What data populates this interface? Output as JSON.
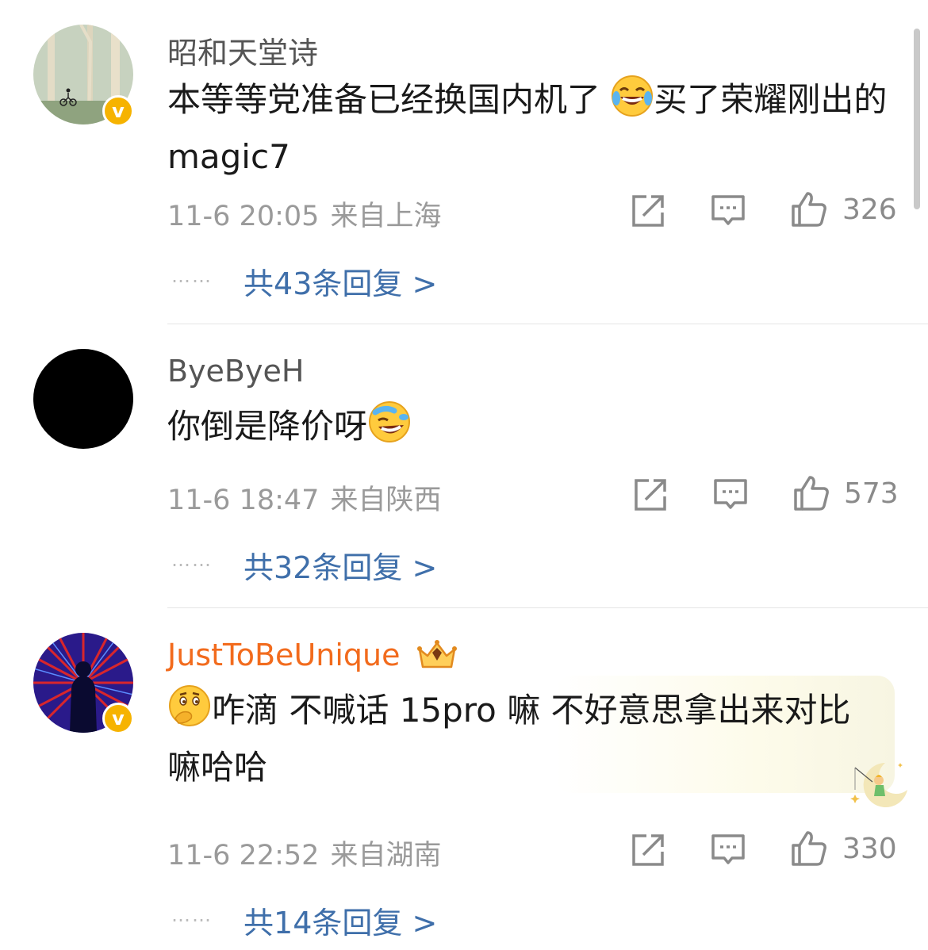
{
  "comments": [
    {
      "username": "昭和天堂诗",
      "text_before": "本等等党准备已经换国内机了",
      "emoji_1": "laughing-tears-emoji",
      "text_after": "买了荣耀刚出的 magic7",
      "date": "11-6 20:05",
      "location": "来自上海",
      "likes": "326",
      "replies_prefix": "共",
      "replies_count": "43",
      "replies_suffix": "条回复 >"
    },
    {
      "username": "ByeByeH",
      "text_before": "你倒是降价呀",
      "emoji_1": "rolling-laugh-emoji",
      "text_after": "",
      "date": "11-6 18:47",
      "location": "来自陕西",
      "likes": "573",
      "replies_prefix": "共",
      "replies_count": "32",
      "replies_suffix": "条回复 >"
    },
    {
      "username": "JustToBeUnique",
      "text_before": "",
      "emoji_1": "thinking-emoji",
      "text_after": "咋滴 不喊话 15pro 嘛 不好意思拿出来对比嘛哈哈",
      "date": "11-6 22:52",
      "location": "来自湖南",
      "likes": "330",
      "replies_prefix": "共",
      "replies_count": "14",
      "replies_suffix": "条回复 >"
    }
  ],
  "dots": "……",
  "colors": {
    "vip_name": "#f26b1d",
    "reply_link": "#3f6faa",
    "badge": "#f6b300",
    "meta": "#9a9a9a"
  }
}
